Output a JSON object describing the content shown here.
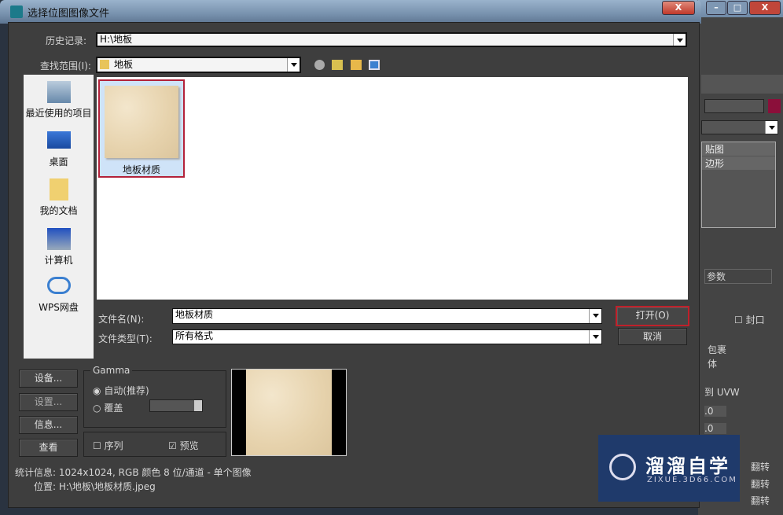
{
  "dialog": {
    "title": "选择位图图像文件",
    "close_label": "X"
  },
  "history": {
    "label": "历史记录:",
    "value": "H:\\地板"
  },
  "lookin": {
    "label": "查找范围(I):",
    "value": "地板",
    "toolbar_icons": [
      "back-icon",
      "up-folder-icon",
      "new-folder-icon",
      "view-menu-icon"
    ]
  },
  "places": [
    {
      "label": "最近使用的项目",
      "icon": "recent-icon"
    },
    {
      "label": "桌面",
      "icon": "desktop-icon"
    },
    {
      "label": "我的文档",
      "icon": "documents-icon"
    },
    {
      "label": "计算机",
      "icon": "computer-icon"
    },
    {
      "label": "WPS网盘",
      "icon": "cloud-icon"
    }
  ],
  "files": [
    {
      "name": "地板材质",
      "selected": true
    }
  ],
  "filename": {
    "label": "文件名(N):",
    "value": "地板材质"
  },
  "filetype": {
    "label": "文件类型(T):",
    "value": "所有格式"
  },
  "buttons": {
    "open": "打开(O)",
    "cancel": "取消",
    "devices": "设备...",
    "setup": "设置...",
    "info": "信息...",
    "view": "查看"
  },
  "gamma": {
    "title": "Gamma",
    "auto": "自动(推荐)",
    "override": "覆盖",
    "auto_checked": true
  },
  "options": {
    "sequence": "序列",
    "sequence_checked": false,
    "preview": "预览",
    "preview_checked": true
  },
  "stats": {
    "label": "统计信息:",
    "value": "1024x1024, RGB 颜色 8 位/通道 - 单个图像"
  },
  "location": {
    "label": "位置:",
    "value": "H:\\地板\\地板材质.jpeg"
  },
  "background_app": {
    "list": [
      "贴图",
      "边形"
    ],
    "rollout": "参数",
    "cap": "封口",
    "items": [
      "包裹",
      "体",
      "到 UVW"
    ],
    "spin1": ".0",
    "spin2": ".0",
    "flip": [
      "翻转",
      "翻转",
      "翻转"
    ],
    "accent": "#8b0f3a"
  },
  "watermark": {
    "title": "溜溜自学",
    "url": "ZIXUE.3D66.COM"
  }
}
